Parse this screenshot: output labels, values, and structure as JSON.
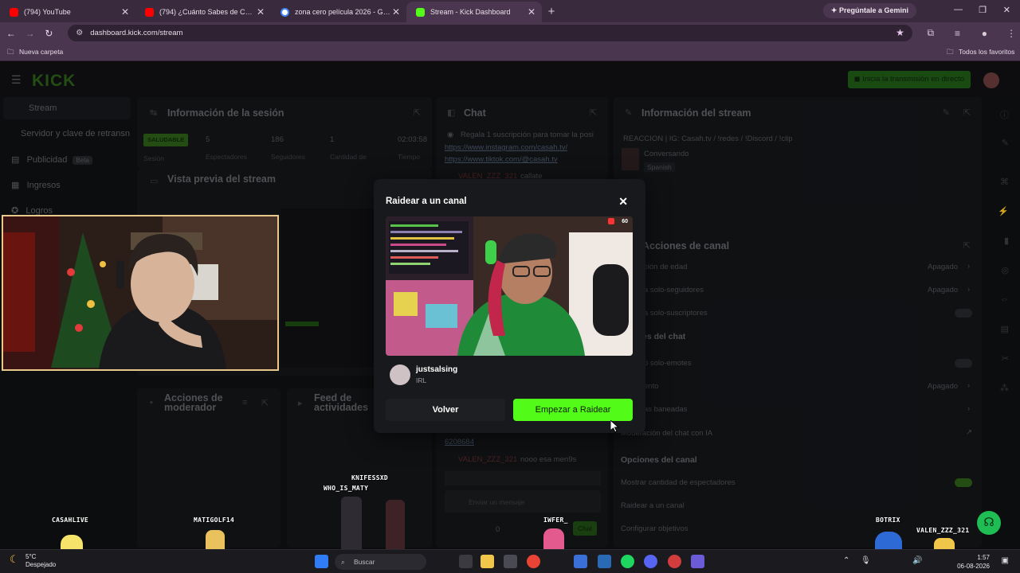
{
  "browser": {
    "tabs": [
      {
        "label": "(794) YouTube",
        "favicon_color": "#ff0000",
        "active": false
      },
      {
        "label": "(794) ¿Cuánto Sabes de Cultura",
        "favicon_color": "#ff0000",
        "active": false
      },
      {
        "label": "zona cero película 2026 - Goog",
        "favicon_color": "#4285f4",
        "active": false
      },
      {
        "label": "Stream - Kick Dashboard",
        "favicon_color": "#53fc18",
        "active": true
      }
    ],
    "new_tab": "+",
    "gemini_button": "Pregúntale a Gemini",
    "url": "dashboard.kick.com/stream",
    "bookmark_folder": "Nueva carpeta",
    "all_bookmarks": "Todos los favoritos"
  },
  "dashboard": {
    "logo": "KICK",
    "go_live": "Inicia la transmisión en directo",
    "sidebar": [
      {
        "label": "Stream",
        "active": true
      },
      {
        "label": "Servidor y clave de retransn"
      },
      {
        "label": "Publicidad",
        "badge": "Beta"
      },
      {
        "label": "Ingresos"
      },
      {
        "label": "Logros"
      }
    ],
    "session": {
      "title": "Información de la sesión",
      "status": "SALUDABLE",
      "status_caption": "Sesión",
      "stats": [
        {
          "value": "5",
          "label": "Espectadores"
        },
        {
          "value": "186",
          "label": "Seguidores"
        },
        {
          "value": "1",
          "label": "Cantidad de"
        },
        {
          "value": "02:03:58",
          "label": "Tiempo"
        }
      ]
    },
    "preview_panel_title": "Vista previa del stream",
    "chat": {
      "title": "Chat",
      "pinned": "Regala 1 suscripción para tomar la posi",
      "links": [
        "https://www.instagram.com/casah.tv/",
        "https://www.tiktok.com/@casah.tv"
      ],
      "msg1_user": "VALEN_ZZZ_321",
      "msg1_text": "callate",
      "msg2_id": "6208684",
      "msg3_user": "VALEN_ZZZ_321",
      "msg3_text": "nooo esa men9s",
      "input_placeholder": "Enviar un mensaje",
      "count": "0",
      "send": "Chat"
    },
    "stream_info": {
      "title": "Información del stream",
      "stream_title": "REACCION | IG: Casah.tv / !redes / !Discord / !clip",
      "category": "Conversando",
      "language": "Spanish"
    },
    "channel_actions": {
      "title": "Acciones de canal",
      "rows": [
        {
          "label": "ción de edad",
          "value": "Apagado"
        },
        {
          "label": "a solo-seguidores",
          "value": "Apagado"
        },
        {
          "label": "a solo-suscriptores",
          "value": ""
        }
      ],
      "chat_header": "es del chat",
      "chat_rows": [
        {
          "label": "o solo-emotes",
          "value": ""
        },
        {
          "label": "ento",
          "value": "Apagado"
        },
        {
          "label": "as baneadas",
          "value": ""
        },
        {
          "label": "Moderación del chat con IA",
          "value": ""
        }
      ],
      "channel_header": "Opciones del canal",
      "channel_rows": [
        {
          "label": "Mostrar cantidad de espectadores"
        },
        {
          "label": "Raidear a un canal"
        },
        {
          "label": "Configurar objetivos"
        }
      ]
    },
    "mod_actions_title": "Acciones de moderador",
    "activity_feed_title": "Feed de actividades"
  },
  "modal": {
    "title": "Raidear a un canal",
    "preview_viewers": "60",
    "channel_name": "justsalsing",
    "channel_category": "IRL",
    "back_button": "Volver",
    "raid_button": "Empezar a Raidear"
  },
  "overlay_names": {
    "n1": "CASAHLIVE",
    "n2": "MATIGOLF14",
    "n3": "KNIFESSXD",
    "n4": "WHO_IS_MATY",
    "n5": "IWFER_",
    "n6": "BOTRIX",
    "n7": "VALEN_ZZZ_321"
  },
  "taskbar": {
    "temp": "5°C",
    "weather": "Despejado",
    "search": "Buscar",
    "time": "1:57",
    "date": "06-08-2026"
  },
  "colors": {
    "kick_green": "#53fc18",
    "modal_bg": "#18191c",
    "webcam_border": "#e8c98b"
  }
}
